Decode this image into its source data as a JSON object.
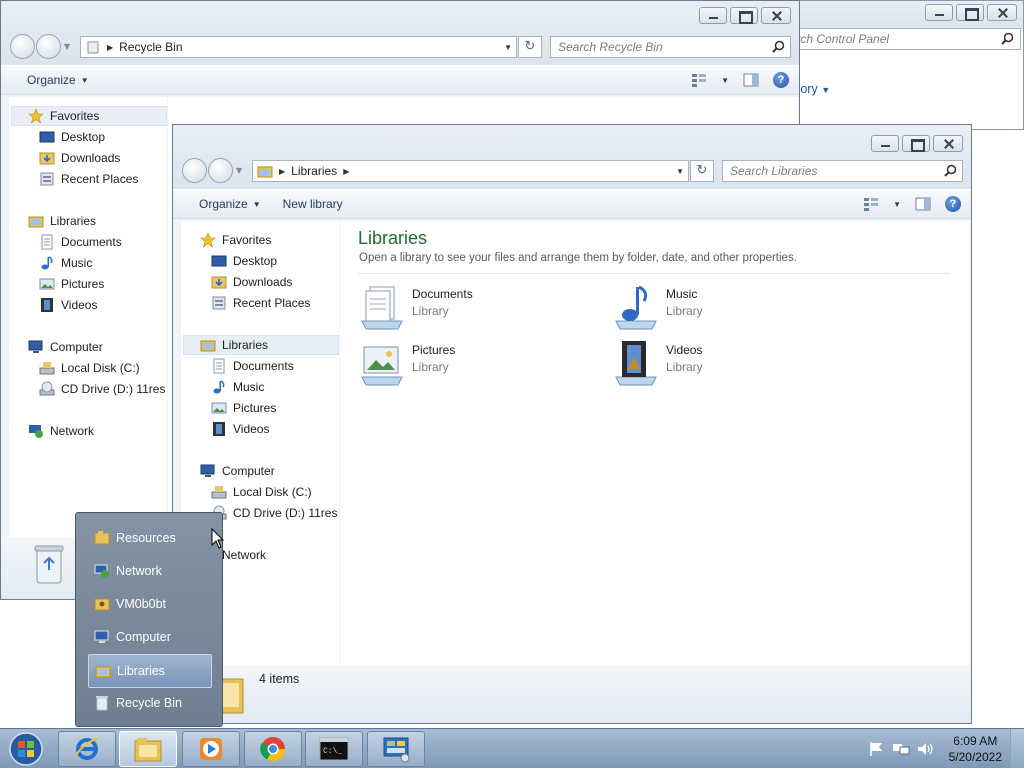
{
  "control_panel": {
    "search_placeholder": "Search Control Panel",
    "category_text": "Category"
  },
  "recycle_window": {
    "address": "Recycle Bin",
    "search_placeholder": "Search Recycle Bin",
    "organize_label": "Organize",
    "nav": {
      "favorites": "Favorites",
      "desktop": "Desktop",
      "downloads": "Downloads",
      "recent_places": "Recent Places",
      "libraries": "Libraries",
      "documents": "Documents",
      "music": "Music",
      "pictures": "Pictures",
      "videos": "Videos",
      "computer": "Computer",
      "local_disk": "Local Disk (C:)",
      "cd_drive": "CD Drive (D:) 11res",
      "network": "Network"
    }
  },
  "libraries_window": {
    "address": "Libraries",
    "search_placeholder": "Search Libraries",
    "organize_label": "Organize",
    "new_library_label": "New library",
    "title": "Libraries",
    "subtitle": "Open a library to see your files and arrange them by folder, date, and other properties.",
    "nav": {
      "favorites": "Favorites",
      "desktop": "Desktop",
      "downloads": "Downloads",
      "recent_places": "Recent Places",
      "libraries": "Libraries",
      "documents": "Documents",
      "music": "Music",
      "pictures": "Pictures",
      "videos": "Videos",
      "computer": "Computer",
      "local_disk": "Local Disk (C:)",
      "cd_drive": "CD Drive (D:) 11res",
      "network": "Network"
    },
    "libraries": [
      {
        "name": "Documents",
        "type": "Library",
        "icon": "documents-library-icon"
      },
      {
        "name": "Music",
        "type": "Library",
        "icon": "music-library-icon"
      },
      {
        "name": "Pictures",
        "type": "Library",
        "icon": "pictures-library-icon"
      },
      {
        "name": "Videos",
        "type": "Library",
        "icon": "videos-library-icon"
      }
    ],
    "status": "4 items"
  },
  "jump_list": {
    "items": [
      {
        "label": "Resources",
        "icon": "folder-icon"
      },
      {
        "label": "Network",
        "icon": "network-icon"
      },
      {
        "label": "VM0b0bt",
        "icon": "user-folder-icon"
      },
      {
        "label": "Computer",
        "icon": "computer-icon"
      },
      {
        "label": "Libraries",
        "icon": "libraries-icon"
      },
      {
        "label": "Recycle Bin",
        "icon": "recycle-bin-icon"
      }
    ],
    "active_item": "Libraries"
  },
  "taskbar": {
    "pinned": [
      "start-button",
      "internet-explorer",
      "windows-explorer",
      "windows-media-player",
      "google-chrome",
      "command-prompt",
      "control-panel"
    ],
    "clock_time": "6:09 AM",
    "clock_date": "5/20/2022"
  }
}
